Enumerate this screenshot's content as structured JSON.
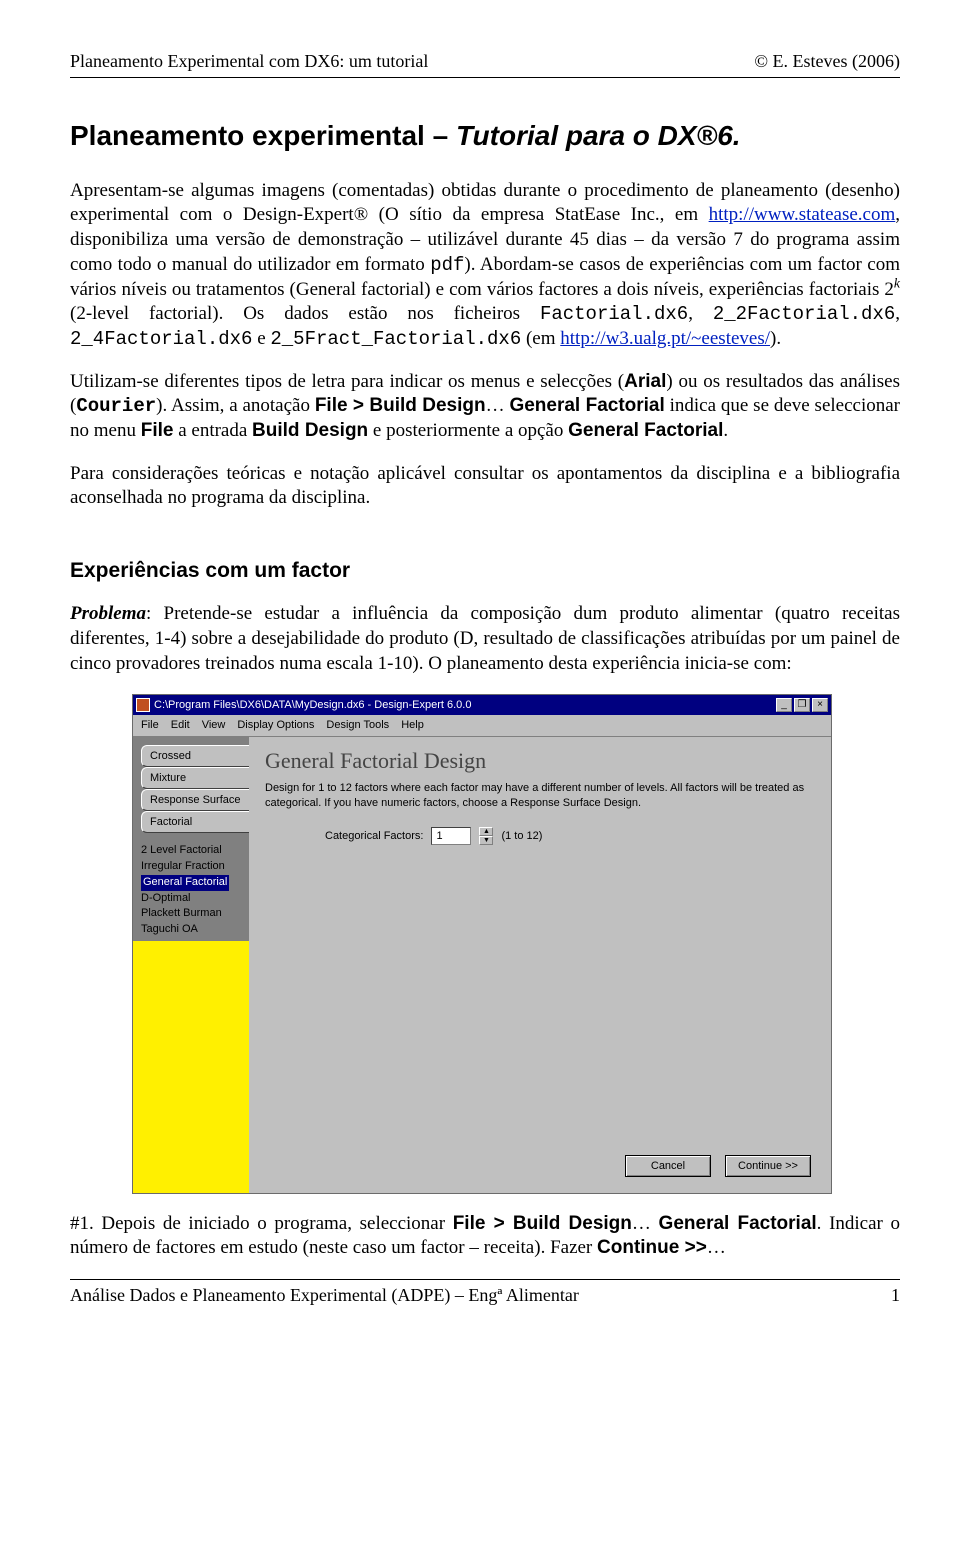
{
  "header": {
    "left": "Planeamento Experimental com DX6: um tutorial",
    "right": "© E. Esteves (2006)"
  },
  "title": {
    "plain": "Planeamento experimental – ",
    "italic": "Tutorial para o DX®6."
  },
  "p1": {
    "a": "Apresentam-se algumas imagens (comentadas) obtidas durante o procedimento de planeamento (desenho) experimental com o Design-Expert® (O sítio da empresa StatEase Inc., em ",
    "link1": "http://www.statease.com",
    "b": ", disponibiliza uma versão de demonstração – utilizável durante 45 dias – da versão 7 do programa assim como todo o manual do utilizador em formato ",
    "pdf": "pdf",
    "c": "). Abordam-se casos de experiências com um factor com vários níveis ou tratamentos (General factorial) e com vários factores a dois níveis, experiências factoriais 2",
    "d": " (2-level factorial). Os dados estão nos ficheiros ",
    "f1": "Factorial.dx6",
    "sep1": ", ",
    "f2": "2_2Factorial.dx6",
    "sep2": ", ",
    "f3": "2_4Factorial.dx6",
    "e": " e ",
    "f4": "2_5Fract_Factorial.dx6",
    "f": " (em ",
    "link2": "http://w3.ualg.pt/~eesteves/",
    "g": ")."
  },
  "p2": {
    "a": "Utilizam-se diferentes tipos de letra para indicar os menus e selecções (",
    "arial": "Arial",
    "b": ") ou os resultados das análises (",
    "courier": "Courier",
    "c": "). Assim, a anotação ",
    "menu1": "File > Build Design",
    "d": "… ",
    "menu2": "General Factorial",
    "e": " indica que se deve seleccionar no menu ",
    "menu3": "File",
    "f": " a entrada ",
    "menu4": "Build Design",
    "g": " e posteriormente a opção ",
    "menu5": "General Factorial",
    "h": "."
  },
  "p3": "Para considerações teóricas e notação aplicável consultar os apontamentos da disciplina e a bibliografia aconselhada no programa da disciplina.",
  "h2": "Experiências com um factor",
  "p4": {
    "lead": "Problema",
    "rest": ": Pretende-se estudar a influência da composição dum produto alimentar (quatro receitas diferentes, 1-4) sobre a desejabilidade do produto (D, resultado de classificações atribuídas por um painel de cinco provadores treinados numa escala 1-10). O planeamento desta experiência inicia-se com:"
  },
  "shot": {
    "title": "C:\\Program Files\\DX6\\DATA\\MyDesign.dx6 - Design-Expert 6.0.0",
    "menus": [
      "File",
      "Edit",
      "View",
      "Display Options",
      "Design Tools",
      "Help"
    ],
    "tabs": [
      "Crossed",
      "Mixture",
      "Response Surface",
      "Factorial"
    ],
    "sublist": [
      "2 Level Factorial",
      "Irregular Fraction",
      "General Factorial",
      "D-Optimal",
      "Plackett Burman",
      "Taguchi OA"
    ],
    "sublist_selected_index": 2,
    "panel_title": "General Factorial Design",
    "panel_desc": "Design for 1 to 12 factors where each factor may have a different number of levels. All factors will be treated as categorical. If you have numeric factors, choose a Response Surface Design.",
    "factors_label": "Categorical Factors:",
    "factors_value": "1",
    "factors_hint": "(1 to 12)",
    "btn_cancel": "Cancel",
    "btn_continue": "Continue >>"
  },
  "p5": {
    "a": "#1. Depois de iniciado o programa, seleccionar ",
    "m1": "File > Build Design",
    "b": "… ",
    "m2": "General Factorial",
    "c": ". Indicar o número de factores em estudo (neste caso um factor – receita). Fazer ",
    "m3": "Continue >>",
    "d": "…"
  },
  "footer": {
    "left": "Análise Dados e Planeamento Experimental (ADPE) – Engª Alimentar",
    "right": "1"
  }
}
